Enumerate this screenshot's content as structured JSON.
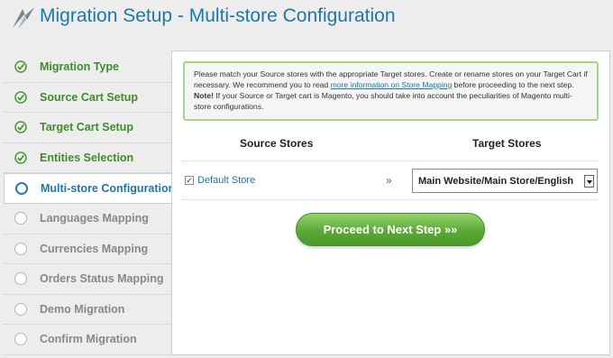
{
  "header": {
    "title": "Migration Setup - Multi-store Configuration"
  },
  "sidebar": {
    "items": [
      {
        "label": "Migration Type",
        "state": "done"
      },
      {
        "label": "Source Cart Setup",
        "state": "done"
      },
      {
        "label": "Target Cart Setup",
        "state": "done"
      },
      {
        "label": "Entities Selection",
        "state": "done"
      },
      {
        "label": "Multi-store Configuration",
        "state": "active"
      },
      {
        "label": "Languages Mapping",
        "state": "todo"
      },
      {
        "label": "Currencies Mapping",
        "state": "todo"
      },
      {
        "label": "Orders Status Mapping",
        "state": "todo"
      },
      {
        "label": "Demo Migration",
        "state": "todo"
      },
      {
        "label": "Confirm Migration",
        "state": "todo"
      }
    ]
  },
  "notice": {
    "text_1": "Please match your Source stores with the appropriate Target stores. Create or rename stores on your Target Cart if necessary. We recommend you to read ",
    "link": "more information on Store Mapping",
    "text_2": " before proceeding to the next step.",
    "note_label": "Note!",
    "note_text": " If your Source or Target cart is Magento, you should take into account the peculiarities of Magento multi-store configurations."
  },
  "table": {
    "source_header": "Source Stores",
    "target_header": "Target Stores",
    "rows": [
      {
        "checked": "✓",
        "source": "Default Store",
        "arrow": "»",
        "target": "Main Website/Main Store/English"
      }
    ]
  },
  "button": {
    "label": "Proceed to Next Step »»"
  },
  "colors": {
    "accent": "#1f77a8",
    "done": "#3d8d2a",
    "button": "#5aa935"
  }
}
